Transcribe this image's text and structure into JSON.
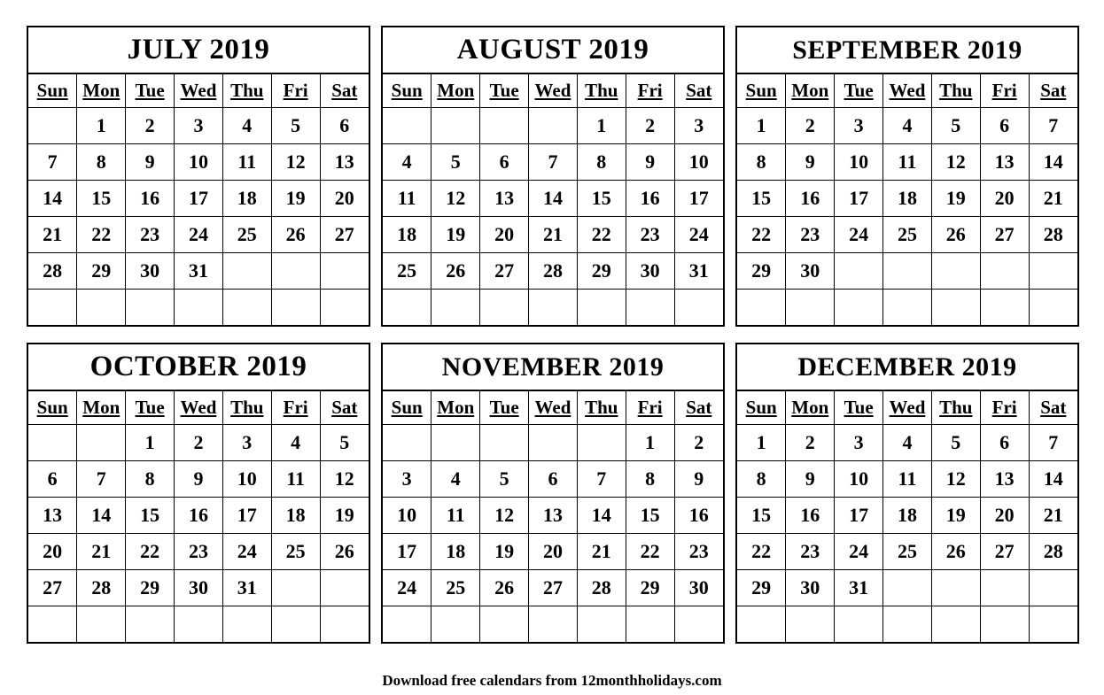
{
  "page": {
    "year": "2019",
    "footer_text": "Download free calendars from 12monthholidays.com",
    "ink_color": "#000000",
    "background_color": "#ffffff"
  },
  "weekday_headers": [
    "Sun",
    "Mon",
    "Tue",
    "Wed",
    "Thu",
    "Fri",
    "Sat"
  ],
  "months": [
    {
      "title": "JULY 2019",
      "name": "July",
      "weeks": [
        [
          "",
          "1",
          "2",
          "3",
          "4",
          "5",
          "6"
        ],
        [
          "7",
          "8",
          "9",
          "10",
          "11",
          "12",
          "13"
        ],
        [
          "14",
          "15",
          "16",
          "17",
          "18",
          "19",
          "20"
        ],
        [
          "21",
          "22",
          "23",
          "24",
          "25",
          "26",
          "27"
        ],
        [
          "28",
          "29",
          "30",
          "31",
          "",
          "",
          ""
        ],
        [
          "",
          "",
          "",
          "",
          "",
          "",
          ""
        ]
      ]
    },
    {
      "title": "AUGUST 2019",
      "name": "August",
      "weeks": [
        [
          "",
          "",
          "",
          "",
          "1",
          "2",
          "3"
        ],
        [
          "4",
          "5",
          "6",
          "7",
          "8",
          "9",
          "10"
        ],
        [
          "11",
          "12",
          "13",
          "14",
          "15",
          "16",
          "17"
        ],
        [
          "18",
          "19",
          "20",
          "21",
          "22",
          "23",
          "24"
        ],
        [
          "25",
          "26",
          "27",
          "28",
          "29",
          "30",
          "31"
        ],
        [
          "",
          "",
          "",
          "",
          "",
          "",
          ""
        ]
      ]
    },
    {
      "title": "SEPTEMBER 2019",
      "name": "September",
      "weeks": [
        [
          "1",
          "2",
          "3",
          "4",
          "5",
          "6",
          "7"
        ],
        [
          "8",
          "9",
          "10",
          "11",
          "12",
          "13",
          "14"
        ],
        [
          "15",
          "16",
          "17",
          "18",
          "19",
          "20",
          "21"
        ],
        [
          "22",
          "23",
          "24",
          "25",
          "26",
          "27",
          "28"
        ],
        [
          "29",
          "30",
          "",
          "",
          "",
          "",
          ""
        ],
        [
          "",
          "",
          "",
          "",
          "",
          "",
          ""
        ]
      ]
    },
    {
      "title": "OCTOBER 2019",
      "name": "October",
      "weeks": [
        [
          "",
          "",
          "1",
          "2",
          "3",
          "4",
          "5"
        ],
        [
          "6",
          "7",
          "8",
          "9",
          "10",
          "11",
          "12"
        ],
        [
          "13",
          "14",
          "15",
          "16",
          "17",
          "18",
          "19"
        ],
        [
          "20",
          "21",
          "22",
          "23",
          "24",
          "25",
          "26"
        ],
        [
          "27",
          "28",
          "29",
          "30",
          "31",
          "",
          ""
        ],
        [
          "",
          "",
          "",
          "",
          "",
          "",
          ""
        ]
      ]
    },
    {
      "title": "NOVEMBER 2019",
      "name": "November",
      "weeks": [
        [
          "",
          "",
          "",
          "",
          "",
          "1",
          "2"
        ],
        [
          "3",
          "4",
          "5",
          "6",
          "7",
          "8",
          "9"
        ],
        [
          "10",
          "11",
          "12",
          "13",
          "14",
          "15",
          "16"
        ],
        [
          "17",
          "18",
          "19",
          "20",
          "21",
          "22",
          "23"
        ],
        [
          "24",
          "25",
          "26",
          "27",
          "28",
          "29",
          "30"
        ],
        [
          "",
          "",
          "",
          "",
          "",
          "",
          ""
        ]
      ]
    },
    {
      "title": "DECEMBER 2019",
      "name": "December",
      "weeks": [
        [
          "1",
          "2",
          "3",
          "4",
          "5",
          "6",
          "7"
        ],
        [
          "8",
          "9",
          "10",
          "11",
          "12",
          "13",
          "14"
        ],
        [
          "15",
          "16",
          "17",
          "18",
          "19",
          "20",
          "21"
        ],
        [
          "22",
          "23",
          "24",
          "25",
          "26",
          "27",
          "28"
        ],
        [
          "29",
          "30",
          "31",
          "",
          "",
          "",
          ""
        ],
        [
          "",
          "",
          "",
          "",
          "",
          "",
          ""
        ]
      ]
    }
  ]
}
